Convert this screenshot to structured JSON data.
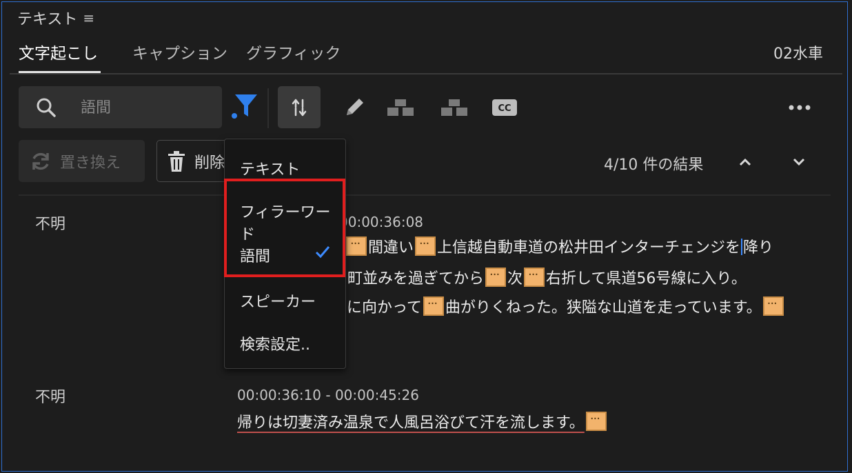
{
  "panel": {
    "title": "テキスト",
    "menu_icon": "hamburger-icon"
  },
  "tabs": [
    {
      "label": "文字起こし",
      "active": true
    },
    {
      "label": "キャプション",
      "active": false
    },
    {
      "label": "グラフィック",
      "active": false
    }
  ],
  "sequence_name": "02水車",
  "search": {
    "value": "",
    "placeholder": "語間"
  },
  "toolbar": {
    "icons": [
      "search-icon",
      "filter-icon",
      "split-icon",
      "pencil-icon",
      "merge-left-icon",
      "merge-right-icon",
      "cc-icon",
      "more-icon"
    ]
  },
  "actions": {
    "replace_label": "置き換え",
    "delete_label": "削除"
  },
  "results": {
    "label": "4/10 件の結果"
  },
  "filter_menu": {
    "items": [
      {
        "label": "テキスト",
        "checked": false
      },
      {
        "label": "フィラーワード",
        "checked": false
      },
      {
        "label": "語間",
        "checked": true
      },
      {
        "label": "スピーカー",
        "checked": false
      },
      {
        "label": "検索設定..",
        "checked": false
      }
    ]
  },
  "transcript": [
    {
      "speaker": "不明",
      "timecode": "00:00:36:08",
      "lines": [
        {
          "before": "",
          "t1": "間違い",
          "t2": "上信越自動車道の松井田インターチェンジを",
          "t3": "降り"
        },
        {
          "t1": "町並みを過ぎてから",
          "t2": "次",
          "t3": "右折して県道56号線に入り。"
        },
        {
          "t1": "に向かって",
          "t2": "曲がりくねった。狭隘な山道を走っています。"
        }
      ]
    },
    {
      "speaker": "不明",
      "timecode": "00:00:36:10 - 00:00:45:26",
      "lines": [
        {
          "t1": "帰りは切妻済み温泉で人風呂浴びて汗を流します。"
        }
      ]
    }
  ],
  "colors": {
    "accent": "#3d8bff",
    "pause_marker": "#f2b36c",
    "highlight_box": "#e01e1e"
  }
}
